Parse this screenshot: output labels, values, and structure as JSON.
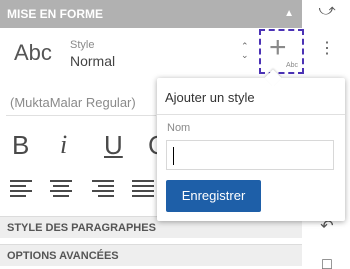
{
  "panel": {
    "title": "MISE EN FORME",
    "collapse_icon": "chevron-up-icon"
  },
  "style": {
    "preview": "Abc",
    "label": "Style",
    "value": "Normal",
    "add_preview": "Abc"
  },
  "font": {
    "value": "(MuktaMalar Regular)"
  },
  "format_buttons": {
    "bold": "B",
    "italic": "i",
    "underline": "U",
    "partial": "C"
  },
  "sections": {
    "paragraph": "STYLE DES PARAGRAPHES",
    "advanced": "OPTIONS AVANCÉES"
  },
  "popup": {
    "title": "Ajouter un style",
    "name_label": "Nom",
    "name_value": "",
    "save_button": "Enregistrer"
  },
  "colors": {
    "header_bg": "#b1b1b1",
    "accent": "#1e5fa8",
    "focus_outline": "#4b32b5"
  }
}
